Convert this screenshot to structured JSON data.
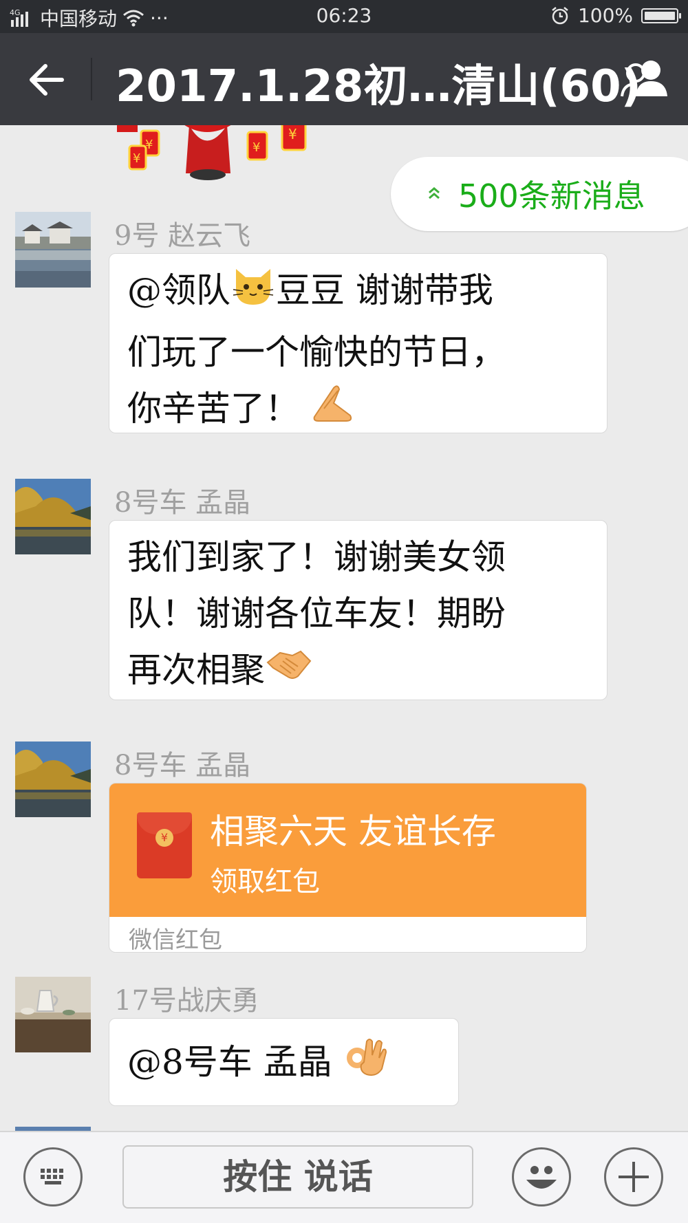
{
  "status_bar": {
    "network": "4G",
    "carrier": "中国移动",
    "dots": "···",
    "time": "06:23",
    "battery": "100%"
  },
  "header": {
    "title": "2017.1.28初…清山(60)",
    "back_icon": "arrow-left-icon",
    "members_icon": "group-members-icon"
  },
  "new_messages": {
    "label": "500条新消息",
    "icon": "double-chevron-up-icon",
    "color": "#1aad19"
  },
  "messages": [
    {
      "sender": "9号   赵云飞",
      "lines": [
        "@领队",
        "豆豆 谢谢带我",
        "们玩了一个愉快的节日，",
        "你辛苦了！"
      ],
      "emoji": [
        "cat-face-emoji",
        "pray-hands-emoji"
      ]
    },
    {
      "sender": "8号车  孟晶",
      "lines": [
        "我们到家了！谢谢美女领",
        "队！谢谢各位车友！期盼",
        "再次相聚"
      ],
      "emoji": [
        "handshake-emoji"
      ]
    },
    {
      "sender": "8号车  孟晶",
      "red_packet": {
        "title": "相聚六天  友谊长存",
        "action": "领取红包",
        "footer": "微信红包",
        "coin": "¥",
        "color": "#fa9d3b"
      }
    },
    {
      "sender": "17号战庆勇",
      "lines": [
        "@8号车  孟晶"
      ],
      "emoji": [
        "ok-hand-emoji"
      ]
    }
  ],
  "input_bar": {
    "hold_to_talk": "按住 说话",
    "keyboard_icon": "keyboard-icon",
    "emoji_icon": "smiley-icon",
    "plus_icon": "plus-icon"
  }
}
